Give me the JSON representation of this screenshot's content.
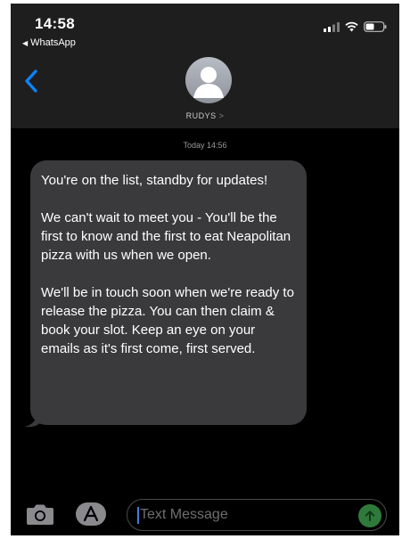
{
  "status_bar": {
    "time": "14:58",
    "back_app": "WhatsApp"
  },
  "header": {
    "contact_name": "RUDYS",
    "contact_chevron": ">"
  },
  "conversation": {
    "timestamp": "Today 14:56",
    "messages": [
      {
        "paragraphs": [
          "You're on the list, standby for updates!",
          "We can't wait to meet you - You'll be the first to know and the first to eat Neapolitan pizza with us when we open.",
          "We'll be in touch soon when we're ready to release the pizza. You can then claim & book your slot. Keep an eye on your emails as it's first come, first served."
        ]
      }
    ]
  },
  "composer": {
    "placeholder": "Text Message"
  },
  "icons": {
    "back": "chevron-left-icon",
    "camera": "camera-icon",
    "apps": "app-store-icon",
    "send": "send-arrow-icon",
    "signal": "signal-icon",
    "wifi": "wifi-icon",
    "battery": "battery-icon"
  },
  "colors": {
    "accent_blue": "#0a84ff",
    "bubble_gray": "#3a3a3c",
    "send_green": "#2f7a3b",
    "background": "#000000"
  }
}
